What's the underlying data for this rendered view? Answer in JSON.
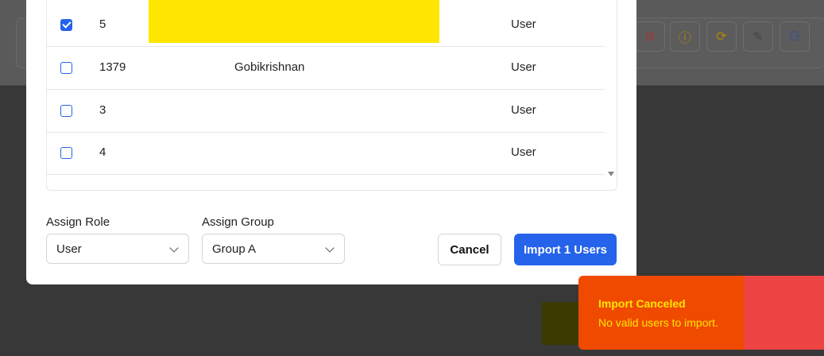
{
  "background_toolbar": {
    "icons": [
      "eye-off-icon",
      "info-icon",
      "refresh-icon",
      "edit-icon",
      "users-icon"
    ]
  },
  "table": {
    "rows": [
      {
        "checked": true,
        "id": "5",
        "name": "",
        "role": "User"
      },
      {
        "checked": false,
        "id": "1379",
        "name": "Gobikrishnan",
        "role": "User"
      },
      {
        "checked": false,
        "id": "3",
        "name": "",
        "role": "User"
      },
      {
        "checked": false,
        "id": "4",
        "name": "",
        "role": "User"
      }
    ]
  },
  "form": {
    "assign_role_label": "Assign Role",
    "assign_role_value": "User",
    "assign_group_label": "Assign Group",
    "assign_group_value": "Group A"
  },
  "actions": {
    "cancel_label": "Cancel",
    "import_label": "Import 1 Users"
  },
  "toast": {
    "title": "Import Canceled",
    "message": "No valid users to import."
  },
  "colors": {
    "primary": "#2563eb",
    "toast_bg": "#ef4444",
    "toast_text": "#ffe600"
  }
}
